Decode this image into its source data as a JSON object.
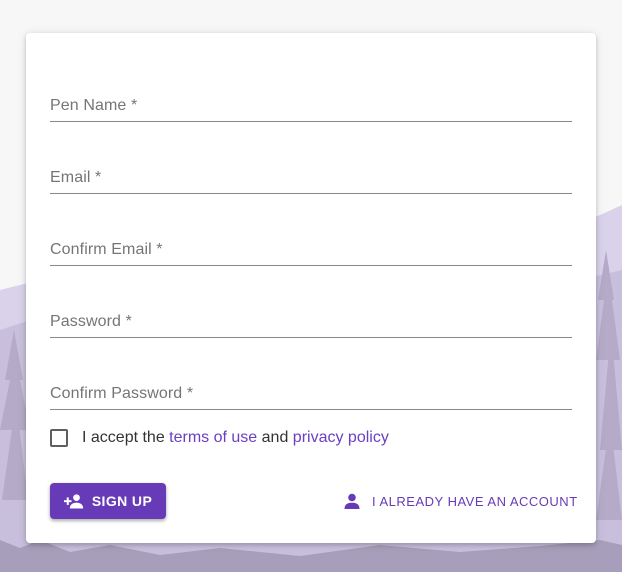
{
  "form": {
    "fields": [
      {
        "label": "Pen Name *"
      },
      {
        "label": "Email *"
      },
      {
        "label": "Confirm Email *"
      },
      {
        "label": "Password *"
      },
      {
        "label": "Confirm Password *"
      }
    ],
    "terms": {
      "prefix": "I accept the ",
      "terms_link": "terms of use",
      "middle": " and ",
      "privacy_link": "privacy policy"
    },
    "signup_label": "SIGN UP",
    "account_label": "I ALREADY HAVE AN ACCOUNT"
  },
  "colors": {
    "accent": "#673ab7",
    "background": "#f7f7f8",
    "card": "#ffffff",
    "mountains": "#d9d2ea"
  },
  "icons": {
    "signup": "person-add-icon",
    "account": "person-icon"
  }
}
